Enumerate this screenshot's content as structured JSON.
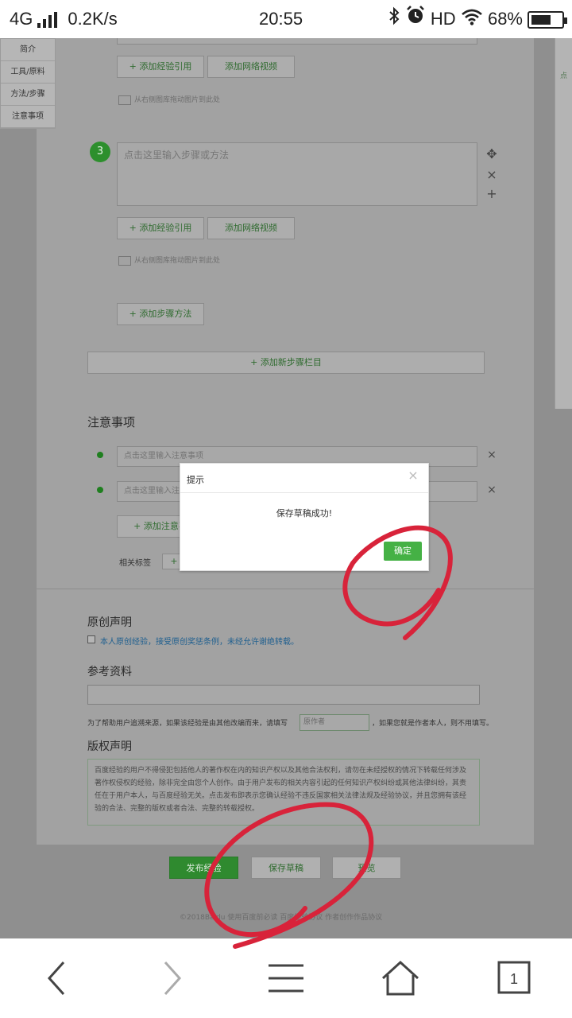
{
  "status_bar": {
    "network": "4G",
    "speed": "0.2K/s",
    "time": "20:55",
    "hd": "HD",
    "battery_percent_text": "68%",
    "battery_level": 0.68,
    "icons": [
      "signal-icon",
      "bluetooth-icon",
      "alarm-icon",
      "wifi-icon",
      "battery-icon"
    ]
  },
  "sidebar": {
    "items": [
      {
        "label": "简介"
      },
      {
        "label": "工具/原料"
      },
      {
        "label": "方法/步骤"
      },
      {
        "label": "注意事项"
      }
    ]
  },
  "steps": {
    "add_reference_label": "+ 添加经验引用",
    "add_video_label": "添加网络视频",
    "image_hint": "从右侧图库拖动图片到此处",
    "step3_number": "3",
    "step3_placeholder": "点击这里输入步骤或方法",
    "add_method_label": "+ 添加步骤方法",
    "add_section_label": "+ 添加新步骤栏目"
  },
  "notes": {
    "heading": "注意事项",
    "placeholder1": "点击这里输入注意事项",
    "placeholder2": "点击这里输入注",
    "add_note_label": "+ 添加注意事",
    "tags_label": "相关标签"
  },
  "declaration": {
    "original_heading": "原创声明",
    "original_checkbox_label": "本人原创经验，接受原创奖惩条例，未经允许谢绝转载。",
    "reference_heading": "参考资料",
    "reference_note_prefix": "为了帮助用户追溯来源，如果该经验是由其他改编而来，请填写",
    "original_author_placeholder": "原作者",
    "reference_note_suffix": "，如果您就是作者本人，则不用填写。",
    "copyright_heading": "版权声明",
    "copyright_text": "百度经验的用户不得侵犯包括他人的著作权在内的知识产权以及其他合法权利，请勿在未经授权的情况下转载任何涉及著作权侵权的经验，除非完全由您个人创作。由于用户发布的相关内容引起的任何知识产权纠纷或其他法律纠纷，其责任在于用户本人，与百度经验无关。点击发布即表示您确认经验不违反国家相关法律法规及经验协议，并且您拥有该经验的合法、完整的版权或者合法、完整的转载授权。"
  },
  "actions": {
    "publish_label": "发布经验",
    "save_draft_label": "保存草稿",
    "preview_label": "预览"
  },
  "footer": {
    "text": "©2018Baidu  使用百度前必读  百度经验协议  作者创作作品协议"
  },
  "dialog": {
    "title": "提示",
    "message": "保存草稿成功!",
    "confirm_label": "确定"
  },
  "navbar": {
    "icons": [
      "back-icon",
      "forward-icon",
      "menu-icon",
      "home-icon",
      "tabs-icon"
    ],
    "tab_count": "1"
  },
  "colors": {
    "accent_green": "#45b145",
    "annotation_red": "#d8233a"
  }
}
